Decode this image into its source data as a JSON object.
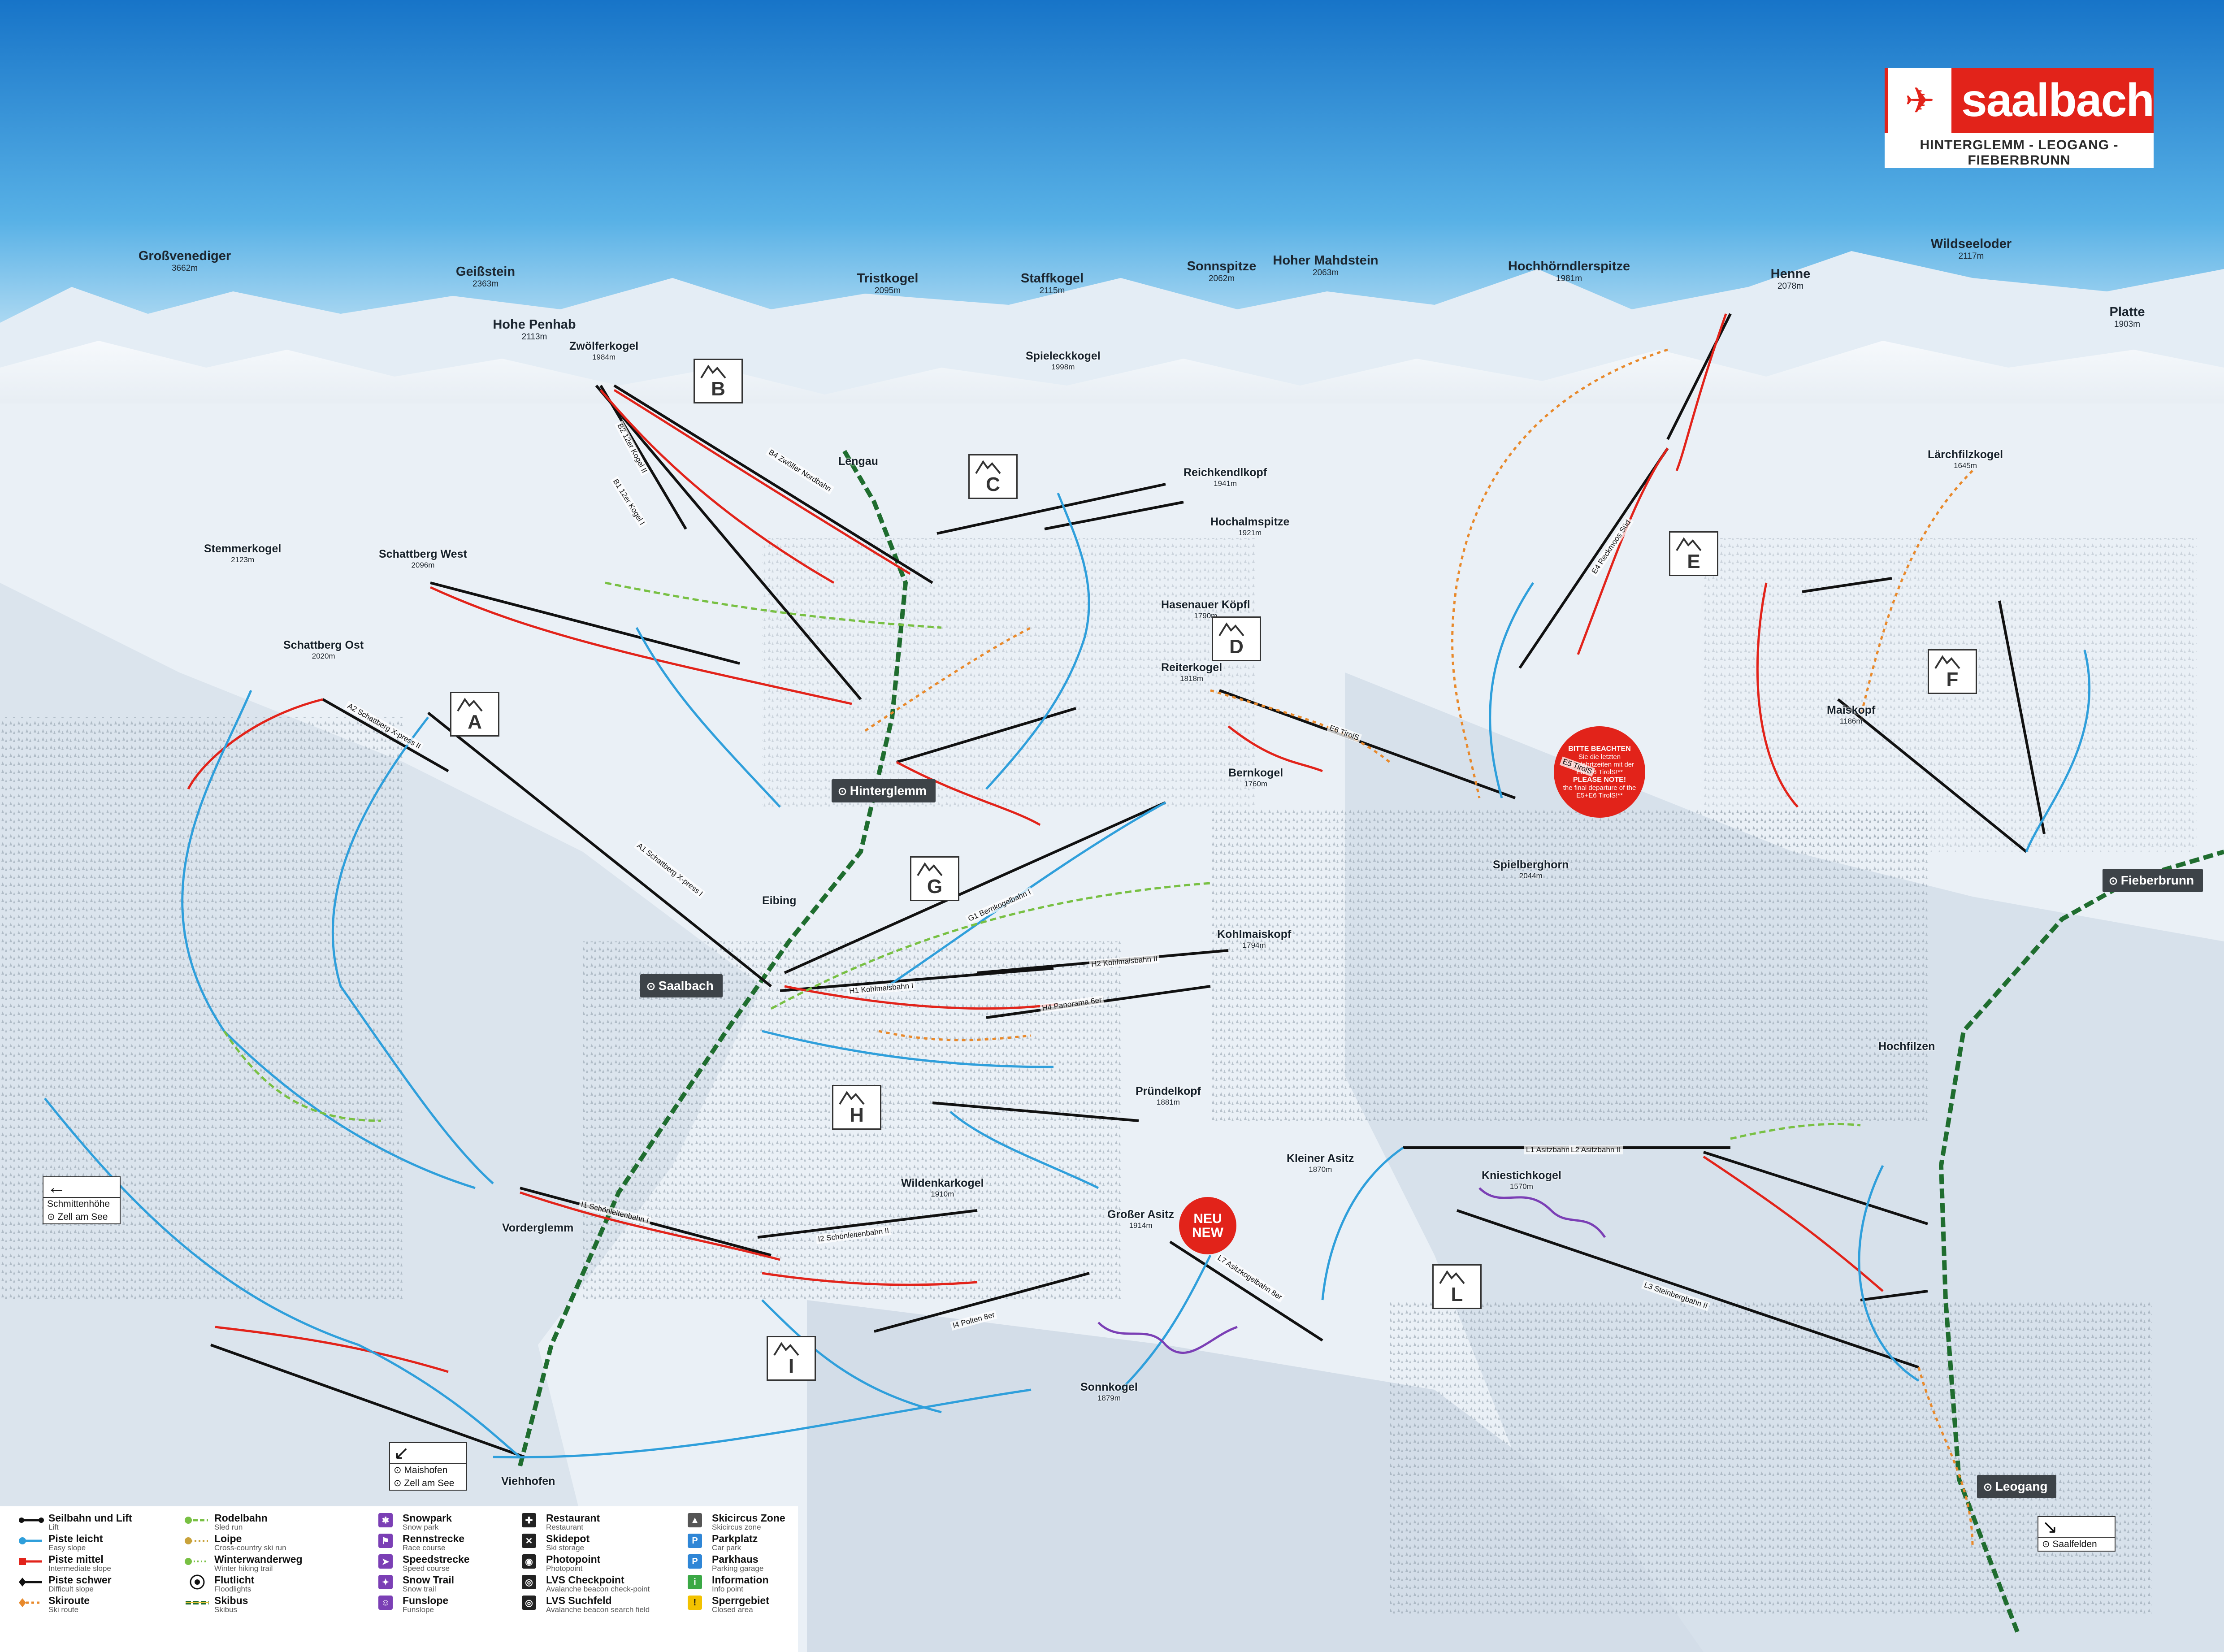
{
  "brand": {
    "name": "saalbach",
    "subtitle": "HINTERGLEMM - LEOGANG - FIEBERBRUNN",
    "emblem_icon": "skier-icon"
  },
  "colors": {
    "sky_top": "#1b7fd1",
    "sky_bottom": "#cfe8f6",
    "snow": "#eef3f8",
    "easy": "#2f9fdb",
    "intermediate": "#e2231a",
    "difficult": "#1a1a1a",
    "skiroute": "#e8892b",
    "sledrun": "#78c043",
    "skibus": "#1f6d2f",
    "funpark": "#7b3fb5",
    "accent_red": "#e2231a"
  },
  "peaks": [
    {
      "name": "Großvenediger",
      "elev": "3662m"
    },
    {
      "name": "Geißstein",
      "elev": "2363m"
    },
    {
      "name": "Hohe Penhab",
      "elev": "2113m"
    },
    {
      "name": "Tristkogel",
      "elev": "2095m"
    },
    {
      "name": "Staffkogel",
      "elev": "2115m"
    },
    {
      "name": "Sonnspitze",
      "elev": "2062m"
    },
    {
      "name": "Hoher Mahdstein",
      "elev": "2063m"
    },
    {
      "name": "Hochhörndlerspitze",
      "elev": "1981m"
    },
    {
      "name": "Henne",
      "elev": "2078m"
    },
    {
      "name": "Wildseeloder",
      "elev": "2117m"
    },
    {
      "name": "Platte",
      "elev": "1903m"
    }
  ],
  "summits": [
    {
      "name": "Zwölferkogel",
      "elev": "1984m"
    },
    {
      "name": "Stemmerkogel",
      "elev": "2123m"
    },
    {
      "name": "Schattberg West",
      "elev": "2096m"
    },
    {
      "name": "Schattberg Ost",
      "elev": "2020m"
    },
    {
      "name": "Spieleckkogel",
      "elev": "1998m"
    },
    {
      "name": "Reichkendlkopf",
      "elev": "1941m"
    },
    {
      "name": "Hochalmspitze",
      "elev": "1921m"
    },
    {
      "name": "Hasenauer Köpfl",
      "elev": "1790m"
    },
    {
      "name": "Reiterkogel",
      "elev": "1818m"
    },
    {
      "name": "Bernkogel",
      "elev": "1760m"
    },
    {
      "name": "Lärchfilzkogel",
      "elev": "1645m"
    },
    {
      "name": "Maiskopf",
      "elev": "1186m"
    },
    {
      "name": "Spielberghorn",
      "elev": "2044m"
    },
    {
      "name": "Kohlmaiskopf",
      "elev": "1794m"
    },
    {
      "name": "Pründelkopf",
      "elev": "1881m"
    },
    {
      "name": "Wildenkarkogel",
      "elev": "1910m"
    },
    {
      "name": "Großer Asitz",
      "elev": "1914m"
    },
    {
      "name": "Kleiner Asitz",
      "elev": "1870m"
    },
    {
      "name": "Kniestichkogel",
      "elev": "1570m"
    },
    {
      "name": "Sonnkogel",
      "elev": "1879m"
    }
  ],
  "places": [
    "Lengau",
    "Eibing",
    "Vorderglemm",
    "Viehhofen",
    "Hochfilzen"
  ],
  "towns": [
    "Hinterglemm",
    "Saalbach",
    "Fieberbrunn",
    "Leogang"
  ],
  "zones": [
    "A",
    "B",
    "C",
    "D",
    "E",
    "F",
    "G",
    "H",
    "I",
    "L"
  ],
  "notice": {
    "title": "BITTE BEACHTEN",
    "text_de": "Sie die letzten Rückfahrtzeiten mit der E5+E6 TirolS!**",
    "title_en": "PLEASE NOTE!",
    "text_en": "the final departure of the E5+E6 TirolS!**"
  },
  "new_badge": [
    "NEU",
    "NEW"
  ],
  "signs": [
    {
      "arrow": "←",
      "rows": [
        "Schmittenhöhe",
        "⊙ Zell am See"
      ]
    },
    {
      "arrow": "↙",
      "rows": [
        "⊙ Maishofen",
        "⊙ Zell am See"
      ]
    },
    {
      "arrow": "↘",
      "rows": [
        "⊙ Saalfelden"
      ]
    }
  ],
  "lifts": [
    {
      "label": "A1 Schattberg X-press I"
    },
    {
      "label": "A2 Schattberg X-press II"
    },
    {
      "label": "B1 12er Kogel I"
    },
    {
      "label": "B2 12er Kogel II"
    },
    {
      "label": "B4 Zwölfer Nordbahn"
    },
    {
      "label": "E6 TirolS"
    },
    {
      "label": "E5 TirolS"
    },
    {
      "label": "E4 Reckmoos Süd"
    },
    {
      "label": "G1 Bernkogelbahn I"
    },
    {
      "label": "H1 Kohlmaisbahn I"
    },
    {
      "label": "H2 Kohlmaisbahn II"
    },
    {
      "label": "H4 Panorama 6er"
    },
    {
      "label": "I1 Schönleitenbahn I"
    },
    {
      "label": "I2 Schönleitenbahn II"
    },
    {
      "label": "I4 Polten 8er"
    },
    {
      "label": "L3 Steinbergbahn II"
    },
    {
      "label": "L1 Asitzbahn I"
    },
    {
      "label": "L2 Asitzbahn II"
    },
    {
      "label": "L7 Asitzkogelbahn 8er"
    }
  ],
  "legend": [
    {
      "de": "Seilbahn und Lift",
      "en": "Lift",
      "sym": "lift"
    },
    {
      "de": "Piste leicht",
      "en": "Easy slope",
      "sym": "easy"
    },
    {
      "de": "Piste mittel",
      "en": "Intermediate slope",
      "sym": "intermediate"
    },
    {
      "de": "Piste schwer",
      "en": "Difficult slope",
      "sym": "difficult"
    },
    {
      "de": "Skiroute",
      "en": "Ski route",
      "sym": "skiroute"
    },
    {
      "de": "Rodelbahn",
      "en": "Sled run",
      "sym": "sledrun"
    },
    {
      "de": "Loipe",
      "en": "Cross-country ski run",
      "sym": "loipe"
    },
    {
      "de": "Winterwanderweg",
      "en": "Winter hiking trail",
      "sym": "hiking"
    },
    {
      "de": "Flutlicht",
      "en": "Floodlights",
      "sym": "floodlight"
    },
    {
      "de": "Skibus",
      "en": "Skibus",
      "sym": "skibus"
    },
    {
      "de": "Snowpark",
      "en": "Snow park",
      "sym": "snowpark"
    },
    {
      "de": "Rennstrecke",
      "en": "Race course",
      "sym": "race"
    },
    {
      "de": "Speedstrecke",
      "en": "Speed course",
      "sym": "speed"
    },
    {
      "de": "Snow Trail",
      "en": "Snow trail",
      "sym": "snowtrail"
    },
    {
      "de": "Funslope",
      "en": "Funslope",
      "sym": "funslope"
    },
    {
      "de": "Restaurant",
      "en": "Restaurant",
      "sym": "restaurant"
    },
    {
      "de": "Skidepot",
      "en": "Ski storage",
      "sym": "skidepot"
    },
    {
      "de": "Photopoint",
      "en": "Photopoint",
      "sym": "photo"
    },
    {
      "de": "LVS Checkpoint",
      "en": "Avalanche beacon check-point",
      "sym": "lvs"
    },
    {
      "de": "LVS Suchfeld",
      "en": "Avalanche beacon search field",
      "sym": "lvssearch"
    },
    {
      "de": "Skicircus Zone",
      "en": "Skicircus zone",
      "sym": "zone"
    },
    {
      "de": "Parkplatz",
      "en": "Car park",
      "sym": "parking"
    },
    {
      "de": "Parkhaus",
      "en": "Parking garage",
      "sym": "garage"
    },
    {
      "de": "Information",
      "en": "Info point",
      "sym": "info"
    },
    {
      "de": "Sperrgebiet",
      "en": "Closed area",
      "sym": "closed"
    }
  ]
}
